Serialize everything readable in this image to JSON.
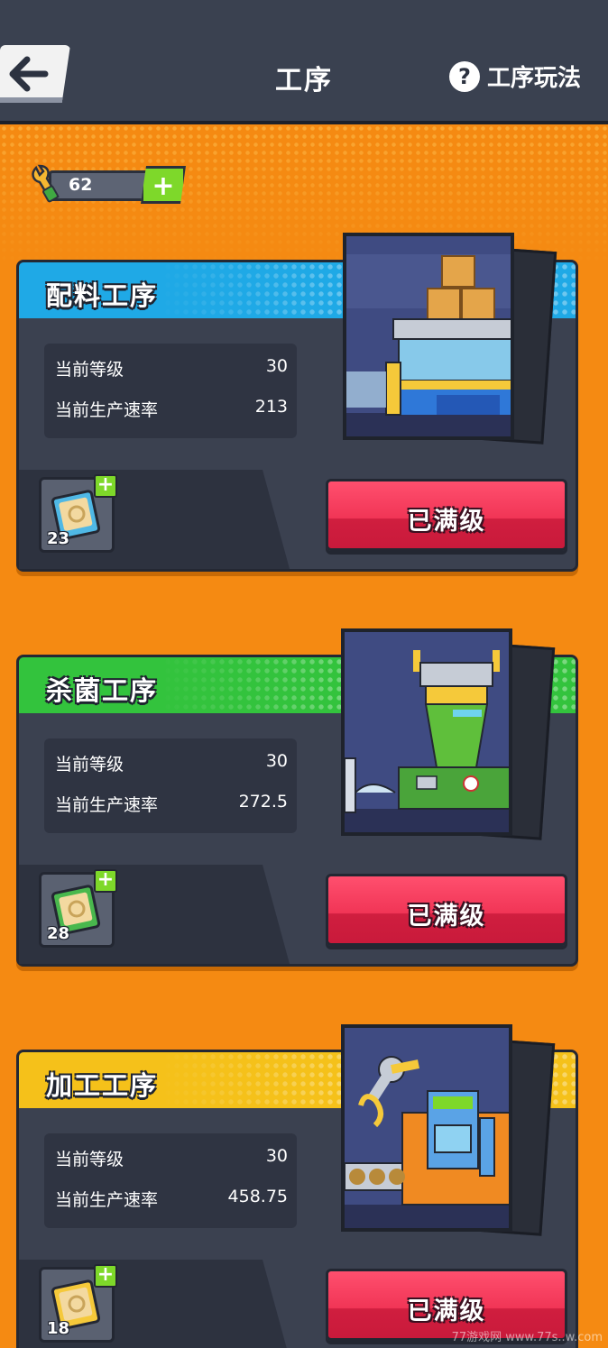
{
  "header": {
    "title": "工序",
    "help_label": "工序玩法",
    "help_icon": "?"
  },
  "currency": {
    "value": "62",
    "plus": "+"
  },
  "cards": [
    {
      "name": "配料工序",
      "header_color": "#1fa9e6",
      "stats": [
        {
          "label": "当前等级",
          "value": "30"
        },
        {
          "label": "当前生产速率",
          "value": "213"
        }
      ],
      "item_count": "23",
      "item_plus": "+",
      "button_label": "已满级"
    },
    {
      "name": "杀菌工序",
      "header_color": "#33c33d",
      "stats": [
        {
          "label": "当前等级",
          "value": "30"
        },
        {
          "label": "当前生产速率",
          "value": "272.5"
        }
      ],
      "item_count": "28",
      "item_plus": "+",
      "button_label": "已满级"
    },
    {
      "name": "加工工序",
      "header_color": "#f5c11a",
      "stats": [
        {
          "label": "当前等级",
          "value": "30"
        },
        {
          "label": "当前生产速率",
          "value": "458.75"
        }
      ],
      "item_count": "18",
      "item_plus": "+",
      "button_label": "已满级"
    }
  ],
  "watermark": "77游戏网 www.77s..w.com"
}
